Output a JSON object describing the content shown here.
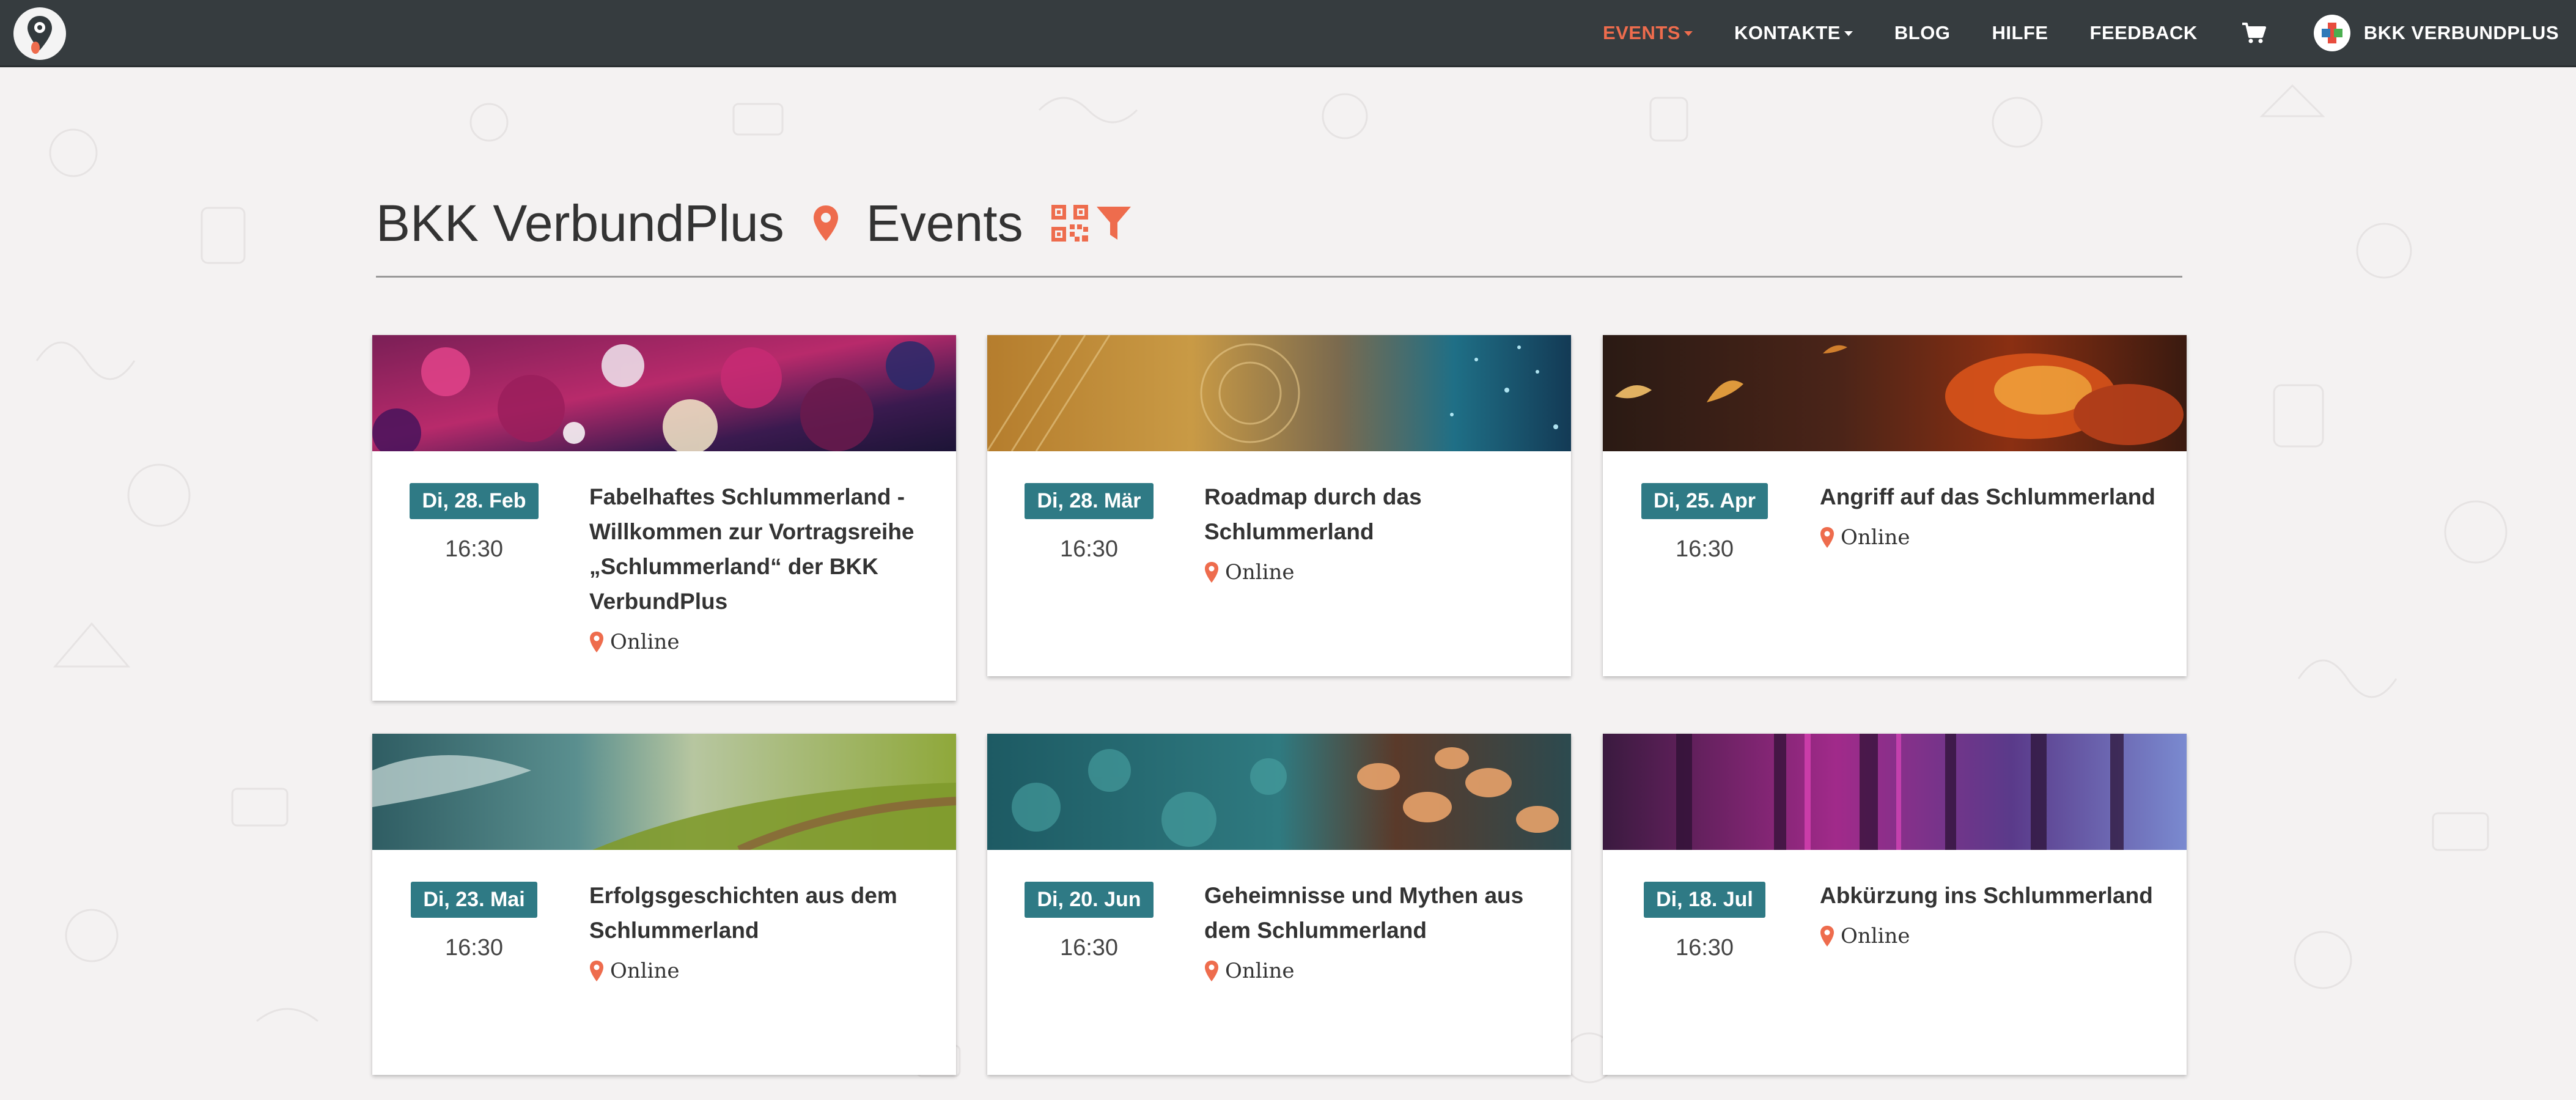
{
  "nav": {
    "logo_alt": "Logo",
    "items": [
      {
        "label": "EVENTS",
        "has_caret": true,
        "active": true
      },
      {
        "label": "KONTAKTE",
        "has_caret": true,
        "active": false
      },
      {
        "label": "BLOG",
        "has_caret": false,
        "active": false
      },
      {
        "label": "HILFE",
        "has_caret": false,
        "active": false
      },
      {
        "label": "FEEDBACK",
        "has_caret": false,
        "active": false
      }
    ],
    "cart_icon": "shopping-cart-icon",
    "account_label": "BKK VERBUNDPLUS"
  },
  "header": {
    "organizer": "BKK VerbundPlus",
    "section": "Events",
    "icons": [
      "map-pin-icon",
      "qr-code-icon",
      "filter-icon"
    ]
  },
  "colors": {
    "accent": "#ee6c4d",
    "navbar": "#363c3f",
    "badge": "#2f7a85",
    "background": "#f4f2f2"
  },
  "events": [
    {
      "date": "Di, 28. Feb",
      "time": "16:30",
      "title": "Fabelhaftes Schlummerland - Willkommen zur Vortragsreihe „Schlummerland“ der BKK VerbundPlus",
      "location": "Online"
    },
    {
      "date": "Di, 28. Mär",
      "time": "16:30",
      "title": "Roadmap durch das Schlummerland",
      "location": "Online"
    },
    {
      "date": "Di, 25. Apr",
      "time": "16:30",
      "title": "Angriff auf das Schlummerland",
      "location": "Online"
    },
    {
      "date": "Di, 23. Mai",
      "time": "16:30",
      "title": "Erfolgsgeschichten aus dem Schlummerland",
      "location": "Online"
    },
    {
      "date": "Di, 20. Jun",
      "time": "16:30",
      "title": "Geheimnisse und Mythen aus dem Schlummerland",
      "location": "Online"
    },
    {
      "date": "Di, 18. Jul",
      "time": "16:30",
      "title": "Abkürzung ins Schlummerland",
      "location": "Online"
    }
  ]
}
